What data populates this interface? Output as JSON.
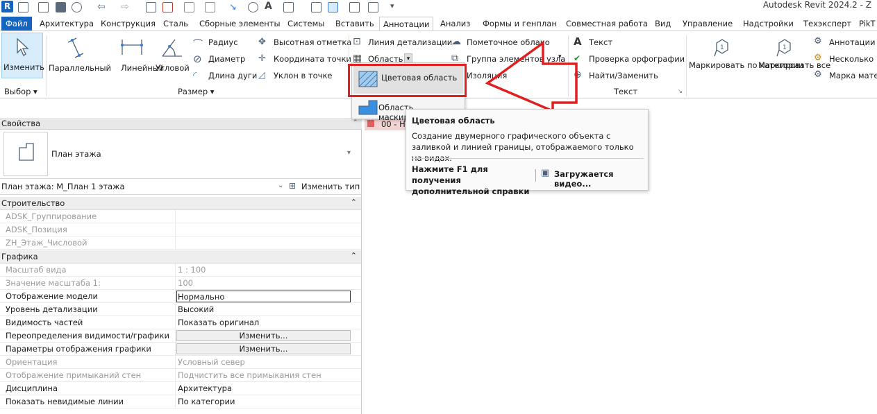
{
  "app": {
    "title": "Autodesk Revit 2024.2 - Z",
    "logo_letter": "R"
  },
  "tabs": [
    {
      "label": "Файл"
    },
    {
      "label": "Архитектура"
    },
    {
      "label": "Конструкция"
    },
    {
      "label": "Сталь"
    },
    {
      "label": "Сборные элементы"
    },
    {
      "label": "Системы"
    },
    {
      "label": "Вставить"
    },
    {
      "label": "Аннотации"
    },
    {
      "label": "Анализ"
    },
    {
      "label": "Формы и генплан"
    },
    {
      "label": "Совместная работа"
    },
    {
      "label": "Вид"
    },
    {
      "label": "Управление"
    },
    {
      "label": "Надстройки"
    },
    {
      "label": "Техэксперт"
    },
    {
      "label": "PikT"
    }
  ],
  "ribbon": {
    "select_panel": {
      "modify_label": "Изменить",
      "panel_title": "Выбор ▾"
    },
    "dimension_panel": {
      "parallel": "Параллельный",
      "linear": "Линейный",
      "angular": "Угловой",
      "radius": "Радиус",
      "diameter": "Диаметр",
      "arc_length": "Длина дуги",
      "spot_elevation": "Высотная отметка",
      "spot_coordinate": "Координата точки",
      "spot_slope": "Уклон в точке",
      "panel_title": "Размер ▾"
    },
    "detail_panel": {
      "detail_line": "Линия детализации",
      "region": "Область",
      "revision_cloud": "Пометочное облако",
      "detail_group": "Группа элементов узла",
      "insulation": "Изоляция"
    },
    "text_panel": {
      "text": "Текст",
      "spelling": "Проверка орфографии",
      "find_replace": "Найти/Заменить",
      "panel_title": "Текст"
    },
    "tag_panel": {
      "tag_by_category": "Маркировать по категории",
      "tag_all": "Маркировать все",
      "annotations": "Аннотации",
      "multiple": "Несколько",
      "material_tag": "Марка мате"
    }
  },
  "region_dropdown": {
    "items": [
      {
        "label": "Цветовая область"
      },
      {
        "label": "Область маскировки"
      }
    ]
  },
  "tooltip": {
    "title": "Цветовая область",
    "description": "Создание двумерного графического объекта с заливкой и линией границы, отображаемого только на видах.",
    "help_hint": "Нажмите F1 для получения дополнительной справки",
    "video": "Загружается видео..."
  },
  "view_tab": {
    "label": "00 - Н"
  },
  "properties": {
    "header": "Свойства",
    "type_name": "План этажа",
    "instance_label": "План этажа: М_План 1 этажа",
    "edit_type": "Изменить тип",
    "sections": [
      {
        "title": "Строительство",
        "rows": [
          {
            "key": "ADSK_Группирование",
            "value": "",
            "grey": true
          },
          {
            "key": "ADSK_Позиция",
            "value": "",
            "grey": true
          },
          {
            "key": "ZH_Этаж_Числовой",
            "value": "",
            "grey": true
          }
        ]
      },
      {
        "title": "Графика",
        "rows": [
          {
            "key": "Масштаб вида",
            "value": "1 : 100",
            "grey": true
          },
          {
            "key": "Значение масштаба    1:",
            "value": "100",
            "grey": true
          },
          {
            "key": "Отображение модели",
            "value": "Нормально",
            "grey": false,
            "boxed": true
          },
          {
            "key": "Уровень детализации",
            "value": "Высокий",
            "grey": false
          },
          {
            "key": "Видимость частей",
            "value": "Показать оригинал",
            "grey": false
          },
          {
            "key": "Переопределения видимости/графики",
            "value": "Изменить...",
            "grey": false,
            "button": true
          },
          {
            "key": "Параметры отображения графики",
            "value": "Изменить...",
            "grey": false,
            "button": true
          },
          {
            "key": "Ориентация",
            "value": "Условный север",
            "grey": true
          },
          {
            "key": "Отображение примыканий стен",
            "value": "Подчистить все примыкания стен",
            "grey": true
          },
          {
            "key": "Дисциплина",
            "value": "Архитектура",
            "grey": false
          },
          {
            "key": "Показать невидимые линии",
            "value": "По категории",
            "grey": false
          }
        ]
      }
    ]
  },
  "colors": {
    "file_tab": "#1565c0",
    "highlight_red": "#e02020",
    "selected_blue": "#d7ecfb"
  }
}
